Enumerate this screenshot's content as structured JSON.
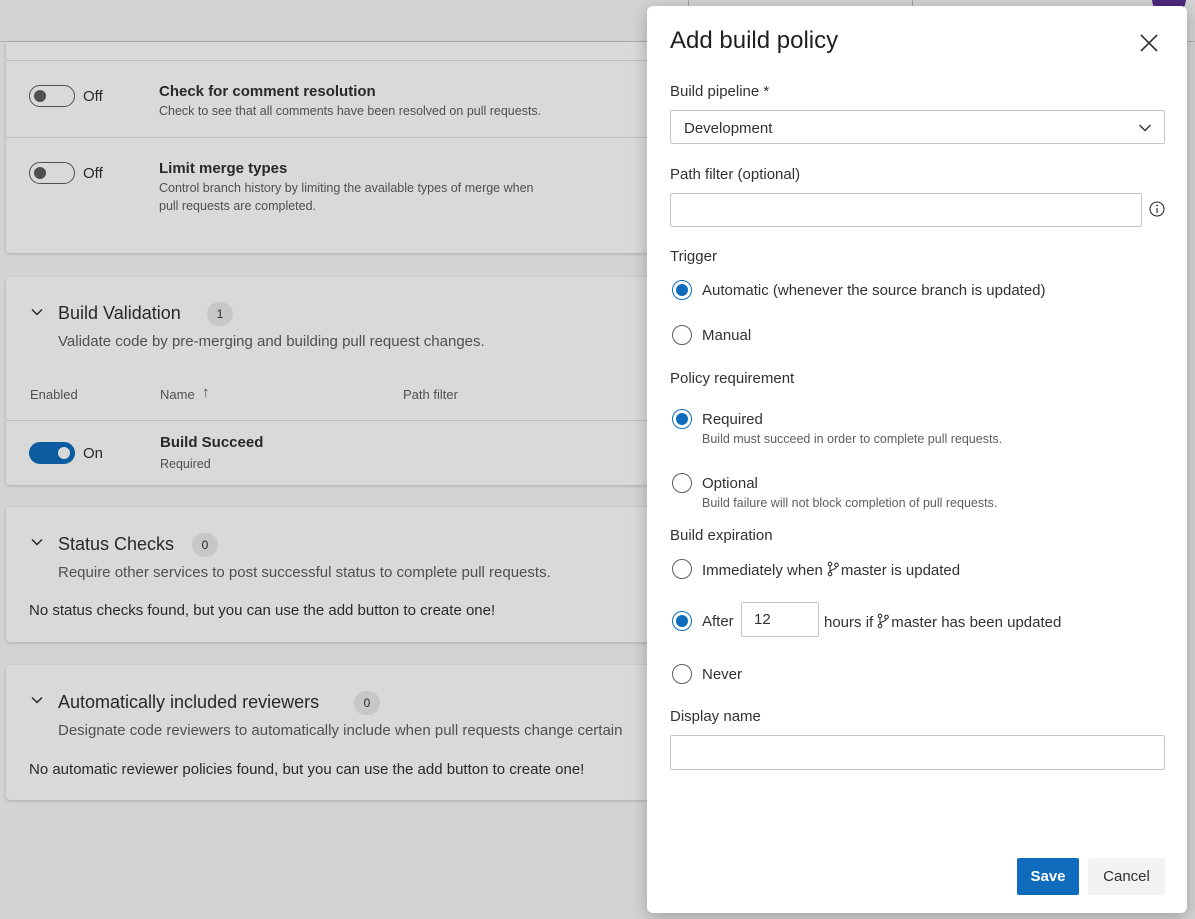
{
  "background": {
    "policies": [
      {
        "title": "Check for comment resolution",
        "desc": [
          "Check to see that all comments have been resolved on pull requests."
        ],
        "toggle": "Off"
      },
      {
        "title": "Limit merge types",
        "desc": [
          "Control branch history by limiting the available types of merge when",
          "pull requests are completed."
        ],
        "toggle": "Off"
      }
    ],
    "build_validation": {
      "title": "Build Validation",
      "count": "1",
      "desc": "Validate code by pre-merging and building pull request changes.",
      "columns": {
        "enabled": "Enabled",
        "name": "Name",
        "sort_arrow": "↑",
        "path_filter": "Path filter"
      },
      "row": {
        "toggle": "On",
        "name": "Build Succeed",
        "status": "Required"
      }
    },
    "status_checks": {
      "title": "Status Checks",
      "count": "0",
      "desc": "Require other services to post successful status to complete pull requests.",
      "empty": "No status checks found, but you can use the add button to create one!"
    },
    "reviewers": {
      "title": "Automatically included reviewers",
      "count": "0",
      "desc": "Designate code reviewers to automatically include when pull requests change certain",
      "empty": "No automatic reviewer policies found, but you can use the add button to create one!"
    }
  },
  "panel": {
    "title": "Add build policy",
    "build_pipeline": {
      "label": "Build pipeline *",
      "value": "Development"
    },
    "path_filter": {
      "label": "Path filter (optional)",
      "value": ""
    },
    "trigger": {
      "label": "Trigger",
      "options": [
        "Automatic (whenever the source branch is updated)",
        "Manual"
      ],
      "selected": 0
    },
    "policy_requirement": {
      "label": "Policy requirement",
      "options": [
        {
          "label": "Required",
          "sub": "Build must succeed in order to complete pull requests."
        },
        {
          "label": "Optional",
          "sub": "Build failure will not block completion of pull requests."
        }
      ],
      "selected": 0
    },
    "build_expiration": {
      "label": "Build expiration",
      "immediately_prefix": "Immediately when",
      "immediately_suffix": "master is updated",
      "after_prefix": "After",
      "after_hours": "12",
      "after_suffix_1": "hours if",
      "after_suffix_2": "master has been updated",
      "never": "Never",
      "selected": 1
    },
    "display_name": {
      "label": "Display name",
      "value": ""
    },
    "buttons": {
      "save": "Save",
      "cancel": "Cancel"
    }
  },
  "colors": {
    "accent": "#0f6cbd",
    "avatar": "#5c2e91"
  },
  "icons": [
    "chevron-down-icon",
    "close-icon",
    "info-icon",
    "branch-icon",
    "sort-up-icon"
  ]
}
